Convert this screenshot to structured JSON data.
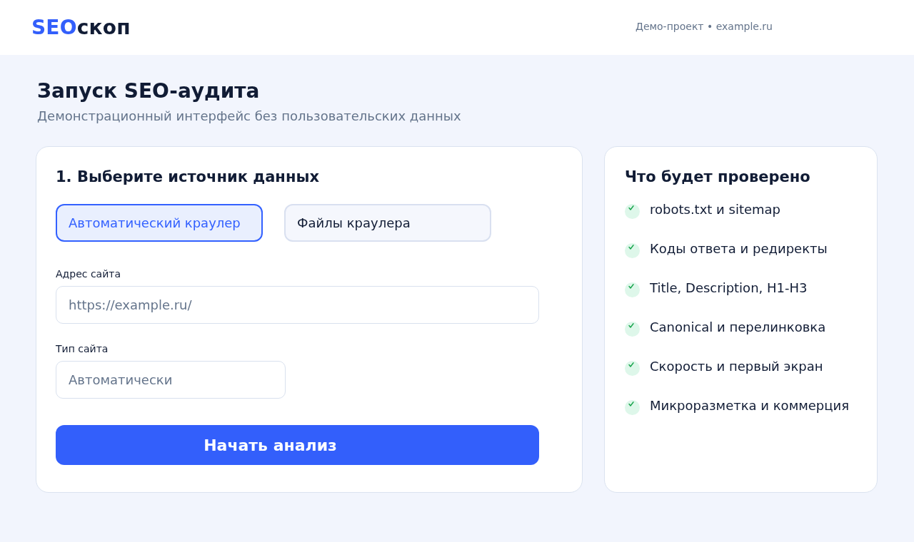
{
  "header": {
    "logo": {
      "accent": "SEO",
      "rest": "скоп"
    },
    "project": "Демо-проект • example.ru"
  },
  "page": {
    "title": "Запуск SEO-аудита",
    "subtitle": "Демонстрационный интерфейс без пользовательских данных"
  },
  "source_card": {
    "title": "1. Выберите источник данных",
    "tabs": [
      {
        "label": "Автоматический краулер",
        "selected": true
      },
      {
        "label": "Файлы краулера",
        "selected": false
      }
    ],
    "fields": [
      {
        "kind": "wide",
        "label": "Адрес сайта",
        "placeholder": "https://example.ru/"
      },
      {
        "kind": "narrow",
        "label": "Тип сайта",
        "placeholder": "Автоматически"
      }
    ],
    "submit": "Начать анализ"
  },
  "checks_card": {
    "title": "Что будет проверено",
    "items": [
      "robots.txt и sitemap",
      "Коды ответа и редиректы",
      "Title, Description, H1-H3",
      "Canonical и перелинковка",
      "Скорость и первый экран",
      "Микроразметка и коммерция"
    ]
  }
}
